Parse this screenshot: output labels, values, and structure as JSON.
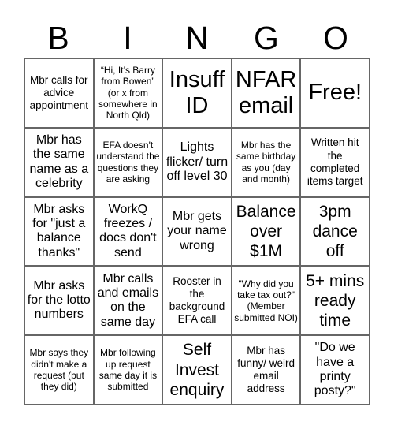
{
  "header": {
    "letters": [
      "B",
      "I",
      "N",
      "G",
      "O"
    ]
  },
  "cells": [
    [
      "Mbr calls for advice appointment",
      "“Hi, It’s Barry from Bowen” (or x from somewhere in North Qld)",
      "Insuff ID",
      "NFAR email",
      "Free!"
    ],
    [
      "Mbr has the same name as a celebrity",
      "EFA doesn't understand the questions they are asking",
      "Lights flicker/ turn off level 30",
      "Mbr has the same birthday as you (day and month)",
      "Written hit the completed items target"
    ],
    [
      "Mbr asks for \"just a balance thanks\"",
      "WorkQ freezes / docs don't send",
      "Mbr gets your name wrong",
      "Balance over $1M",
      "3pm dance off"
    ],
    [
      "Mbr asks for the lotto numbers",
      "Mbr calls and emails on the same day",
      "Rooster in the background EFA call",
      "\"Why did you take tax out?\" (Member submitted NOI)",
      "5+ mins ready time"
    ],
    [
      "Mbr says they didn't make a request (but they did)",
      "Mbr following up request same day it is submitted",
      "Self Invest enquiry",
      "Mbr has funny/ weird email address",
      "\"Do we have a printy posty?\""
    ]
  ]
}
